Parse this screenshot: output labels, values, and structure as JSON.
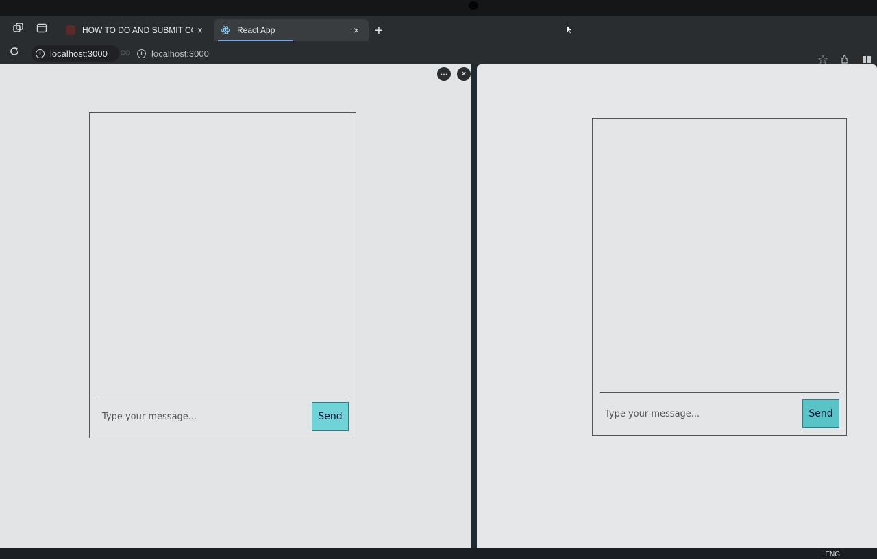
{
  "browser": {
    "tabs": [
      {
        "title": "HOW TO DO AND SUBMIT CODT",
        "active": false
      },
      {
        "title": "React App",
        "active": true
      }
    ],
    "close_glyph": "×",
    "new_tab_glyph": "+",
    "split_urls": [
      "localhost:3000",
      "localhost:3000"
    ],
    "pane_menu_glyph": "⋯",
    "pane_close_glyph": "×"
  },
  "chats": [
    {
      "placeholder": "Type your message...",
      "send_label": "Send"
    },
    {
      "placeholder": "Type your message...",
      "send_label": "Send"
    }
  ],
  "taskbar": {
    "language": "ENG"
  },
  "colors": {
    "send_button": "#6fd3d8",
    "send_button_border": "#2a7f86",
    "active_tab_underline": "#7ba7d8"
  }
}
